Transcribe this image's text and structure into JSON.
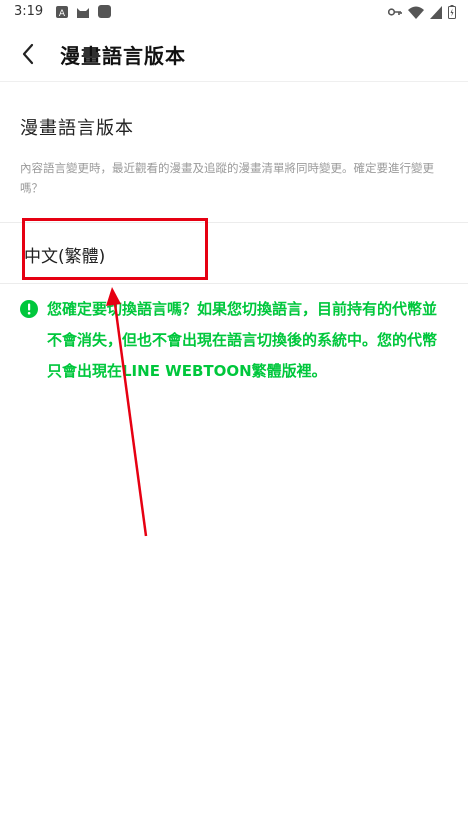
{
  "status_bar": {
    "time": "3:19"
  },
  "header": {
    "title": "漫畫語言版本"
  },
  "section": {
    "title": "漫畫語言版本",
    "description": "內容語言變更時，最近觀看的漫畫及追蹤的漫畫清單將同時變更。確定要進行變更嗎？"
  },
  "language_option": {
    "label": "中文(繁體)"
  },
  "warning": {
    "text": "您確定要切換語言嗎？如果您切換語言，目前持有的代幣並不會消失，但也不會出現在語言切換後的系統中。您的代幣只會出現在LINE WEBTOON繁體版裡。"
  },
  "colors": {
    "accent": "#00c73c",
    "annotation": "#e60012"
  },
  "icons": [
    "back-arrow-icon",
    "warning-icon",
    "wifi-icon",
    "signal-icon",
    "battery-icon",
    "key-icon"
  ]
}
